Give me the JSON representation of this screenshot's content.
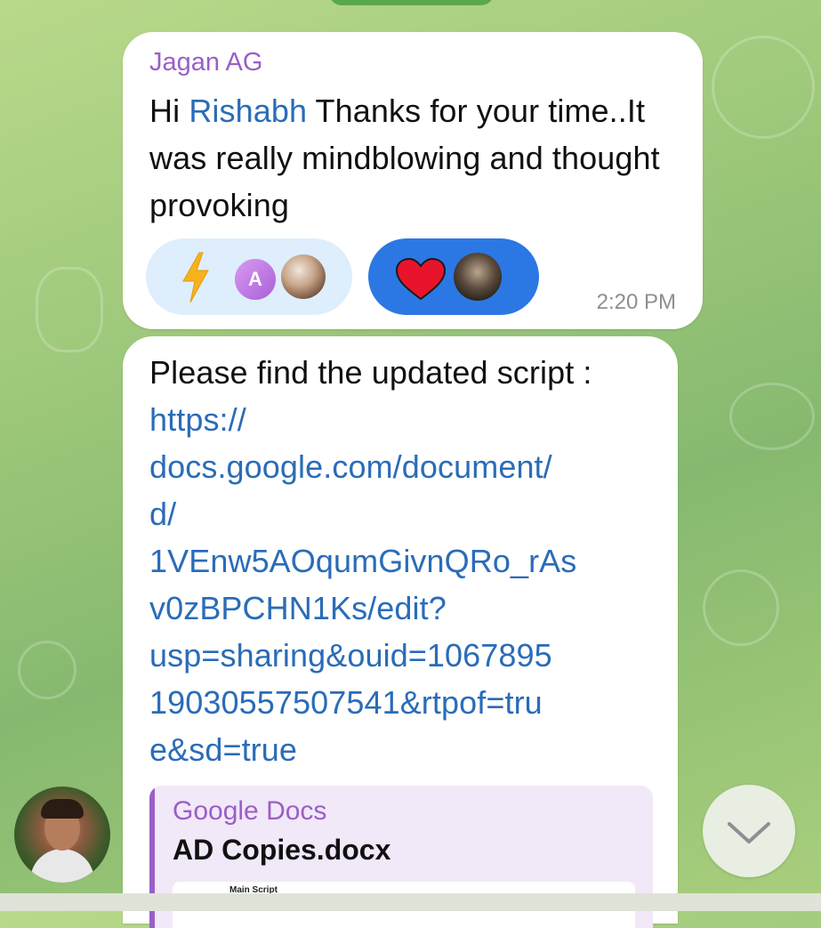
{
  "message1": {
    "sender": "Jagan AG",
    "greeting": "Hi ",
    "mention": "Rishabh",
    "text": " Thanks for your time..It was really mindblowing and thought provoking",
    "reactions": [
      {
        "emoji_icon": "lightning-bolt-icon",
        "avatar_letter": "A"
      },
      {
        "emoji_icon": "heart-icon"
      }
    ],
    "time": "2:20 PM"
  },
  "message2": {
    "text": "Please find the updated script : ",
    "link": "https://docs.google.com/document/d/1VEnw5AOqumGivnQRo_rAsv0zBPCHN1Ks/edit?usp=sharing&ouid=106789519030557507541&rtpof=true&sd=true",
    "link_lines": [
      "https://",
      "docs.google.com/document/",
      "d/",
      "1VEnw5AOqumGivnQRo_rAs",
      "v0zBPCHN1Ks/edit?",
      "usp=sharing&ouid=1067895",
      "19030557507541&rtpof=tru",
      "e&sd=true"
    ],
    "preview": {
      "site": "Google Docs",
      "title": "AD Copies.docx",
      "thumb_text": "Main Script"
    }
  },
  "scroll_button": {
    "icon": "chevron-down-icon"
  },
  "colors": {
    "accent_purple": "#9a5fc6",
    "link_blue": "#2a6cb8",
    "reaction_blue": "#2b78e4"
  }
}
